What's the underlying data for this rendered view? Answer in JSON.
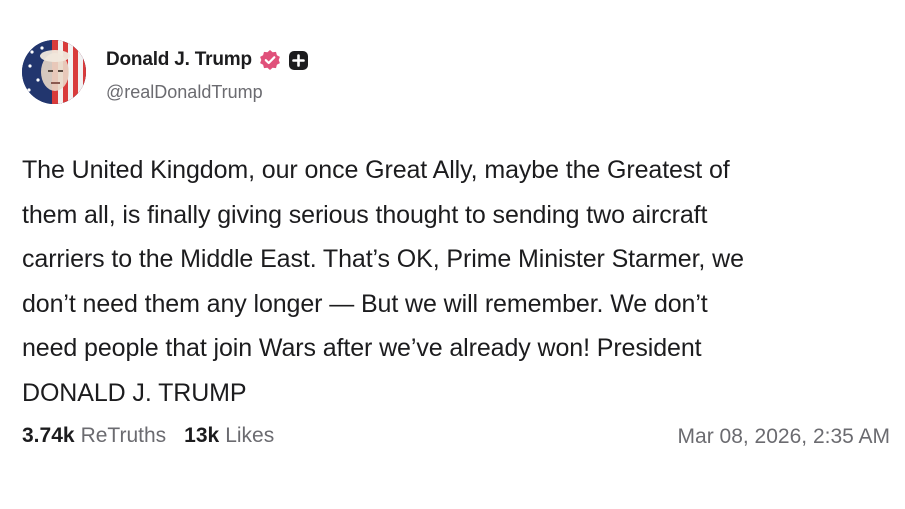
{
  "post": {
    "author": {
      "display_name": "Donald J. Trump",
      "handle": "@realDonaldTrump",
      "verified_icon": "verified-badge-icon",
      "plus_icon": "plus-badge-icon",
      "badge_color": "#e0507a"
    },
    "text": "The United Kingdom, our once Great Ally, maybe the Greatest of\nthem all, is finally giving serious thought to sending two aircraft\ncarriers to the Middle East. That’s OK, Prime Minister Starmer, we\ndon’t need them any longer — But we will remember. We don’t\nneed people that join Wars after we’ve already won! President\nDONALD J. TRUMP",
    "stats": {
      "retruths_count": "3.74k",
      "retruths_label": "ReTruths",
      "likes_count": "13k",
      "likes_label": "Likes"
    },
    "timestamp": "Mar 08, 2026, 2:35 AM"
  }
}
